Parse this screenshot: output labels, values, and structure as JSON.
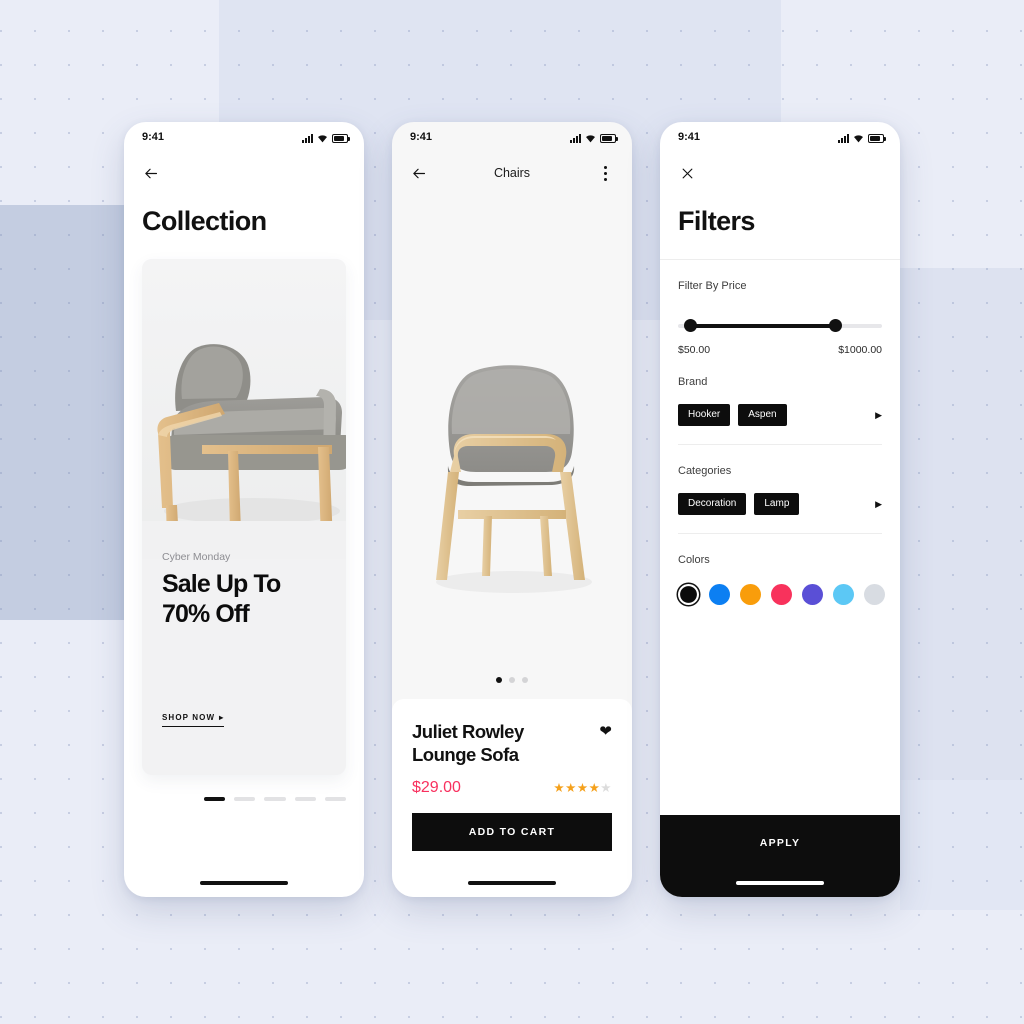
{
  "statusbar": {
    "time": "9:41"
  },
  "screen1": {
    "back_icon": "arrow-left-icon",
    "title": "Collection",
    "promo": {
      "kicker": "Cyber Monday",
      "headline_line1": "Sale Up To",
      "headline_line2": "70% Off",
      "cta": "SHOP NOW",
      "cta_arrow": "▸"
    },
    "pager": {
      "count": 5,
      "active": 0
    }
  },
  "screen2": {
    "back_icon": "arrow-left-icon",
    "title": "Chairs",
    "menu_icon": "kebab-menu-icon",
    "gallery": {
      "dots": 3,
      "active": 0
    },
    "product": {
      "name_line1": "Juliet Rowley",
      "name_line2": "Lounge Sofa",
      "price": "$29.00",
      "price_color": "#f8305e",
      "favorite_icon": "heart-filled-icon",
      "rating": 4,
      "rating_max": 5,
      "star_color": "#f5a11c",
      "star_empty_color": "#dcdcdc",
      "cta": "ADD TO CART"
    }
  },
  "screen3": {
    "close_icon": "close-x-icon",
    "title": "Filters",
    "price_section": {
      "label": "Filter By Price",
      "min_value": "$50.00",
      "max_value": "$1000.00",
      "min_pct": 6,
      "max_pct": 77
    },
    "brand_section": {
      "label": "Brand",
      "chips": [
        "Hooker",
        "Aspen"
      ],
      "expand_icon": "caret-right-icon"
    },
    "categories_section": {
      "label": "Categories",
      "chips": [
        "Decoration",
        "Lamp"
      ],
      "expand_icon": "caret-right-icon"
    },
    "colors_section": {
      "label": "Colors",
      "swatches": [
        {
          "name": "black",
          "hex": "#0b0b0b",
          "selected": true
        },
        {
          "name": "blue",
          "hex": "#0c7ff2",
          "selected": false
        },
        {
          "name": "orange",
          "hex": "#f99d0b",
          "selected": false
        },
        {
          "name": "pink",
          "hex": "#f8325c",
          "selected": false
        },
        {
          "name": "purple",
          "hex": "#5a4fd6",
          "selected": false
        },
        {
          "name": "light-blue",
          "hex": "#5cc8f5",
          "selected": false
        },
        {
          "name": "light-gray",
          "hex": "#d8dce2",
          "selected": false
        }
      ]
    },
    "apply_label": "APPLY"
  }
}
